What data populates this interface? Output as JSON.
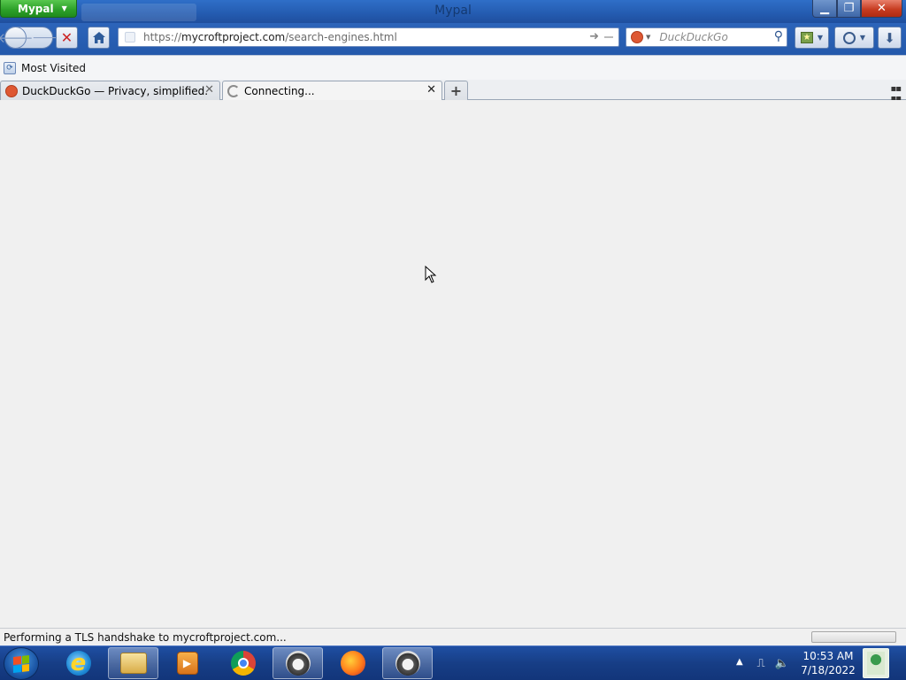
{
  "window": {
    "app_menu_label": "Mypal",
    "title": "Mypal"
  },
  "nav": {
    "url_prefix": "https://",
    "url_domain": "mycroftproject.com",
    "url_path": "/search-engines.html",
    "search_placeholder": "DuckDuckGo"
  },
  "bookmarks": {
    "items": [
      {
        "label": "Most Visited"
      }
    ]
  },
  "tabs": [
    {
      "label": "DuckDuckGo — Privacy, simplified.",
      "favicon": "duckduckgo-icon",
      "active": false
    },
    {
      "label": "Connecting...",
      "favicon": "loading-throbber-icon",
      "active": true
    }
  ],
  "status": {
    "text": "Performing a TLS handshake to mycroftproject.com..."
  },
  "taskbar": {
    "apps": [
      {
        "name": "internet-explorer-icon"
      },
      {
        "name": "file-explorer-icon"
      },
      {
        "name": "media-player-icon"
      },
      {
        "name": "chrome-icon"
      },
      {
        "name": "mypal-raccoon-icon",
        "active": true
      },
      {
        "name": "firefox-icon"
      },
      {
        "name": "mypal-raccoon-icon",
        "active": true
      }
    ],
    "time": "10:53 AM",
    "date": "7/18/2022"
  },
  "colors": {
    "app_menu": "#2ea22a",
    "close_button": "#c73d22",
    "taskbar": "#173e86",
    "content_bg": "#f0f0f0"
  }
}
